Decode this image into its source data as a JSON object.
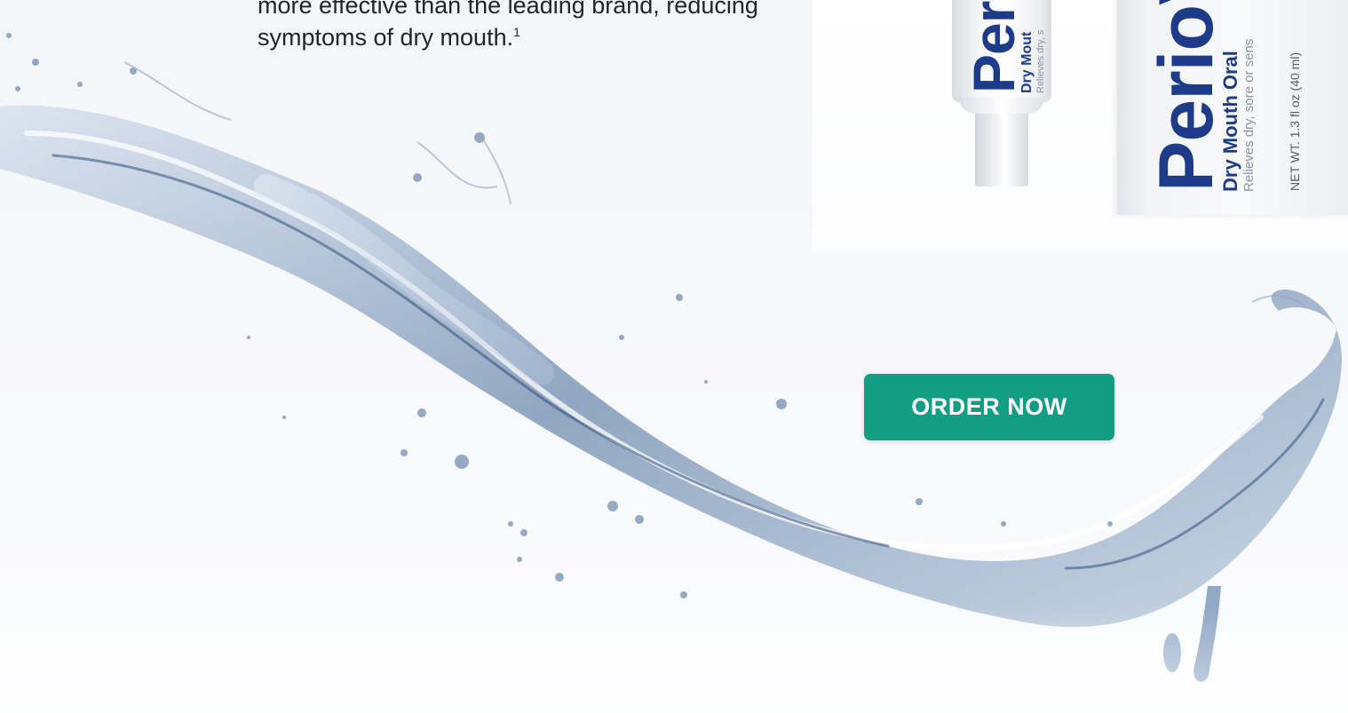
{
  "hero": {
    "text_line1": "more effective than the leading brand, reducing",
    "text_line2": "symptoms of dry mouth.",
    "footnote": "1"
  },
  "product": {
    "brand_tube": "Per",
    "tube_sub1": "Dry Mout",
    "tube_sub2": "Relieves dry, s",
    "brand_box_main": "Perio",
    "brand_box_v": "V",
    "box_sub1": "Dry Mouth Oral",
    "box_sub2": "Relieves dry, sore or sens",
    "net_weight": "NET WT. 1.3 fl oz (40 ml)"
  },
  "cta": {
    "label": "ORDER NOW"
  },
  "colors": {
    "brand_blue": "#1e3b8a",
    "button_green": "#139e84"
  }
}
